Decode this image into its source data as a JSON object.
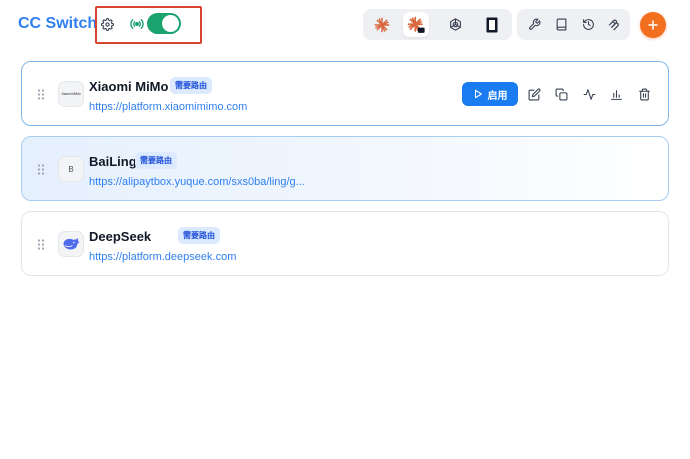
{
  "header": {
    "app_title": "CC Switch",
    "toggle_state": "on",
    "toolbar_left": [
      "claude-burst-icon",
      "claude-code-icon",
      "openai-icon",
      "gemini-box-icon"
    ],
    "toolbar_right": [
      "wrench-icon",
      "book-icon",
      "history-icon",
      "mcp-icon"
    ],
    "add_icon": "plus-icon"
  },
  "colors": {
    "accent": "#2f7ff0",
    "toggle_on": "#1aa36f",
    "add_button": "#f26f1f",
    "highlight": "#d9442c",
    "badge_bg": "#dbeafe",
    "badge_text": "#1d4ed8"
  },
  "providers": [
    {
      "name": "Xiaomi MiMo",
      "badge": "需要路由",
      "url": "https://platform.xiaomimimo.com",
      "logo_text": "Xiaomi MiMo",
      "enable_label": "启用",
      "actions": [
        "edit-icon",
        "duplicate-icon",
        "activity-icon",
        "stats-icon",
        "trash-icon"
      ]
    },
    {
      "name": "BaiLing",
      "badge": "需要路由",
      "url": "https://alipaytbox.yuque.com/sxs0ba/ling/g...",
      "logo_text": "B"
    },
    {
      "name": "DeepSeek",
      "badge": "需要路由",
      "url": "https://platform.deepseek.com",
      "logo_text": ""
    }
  ]
}
